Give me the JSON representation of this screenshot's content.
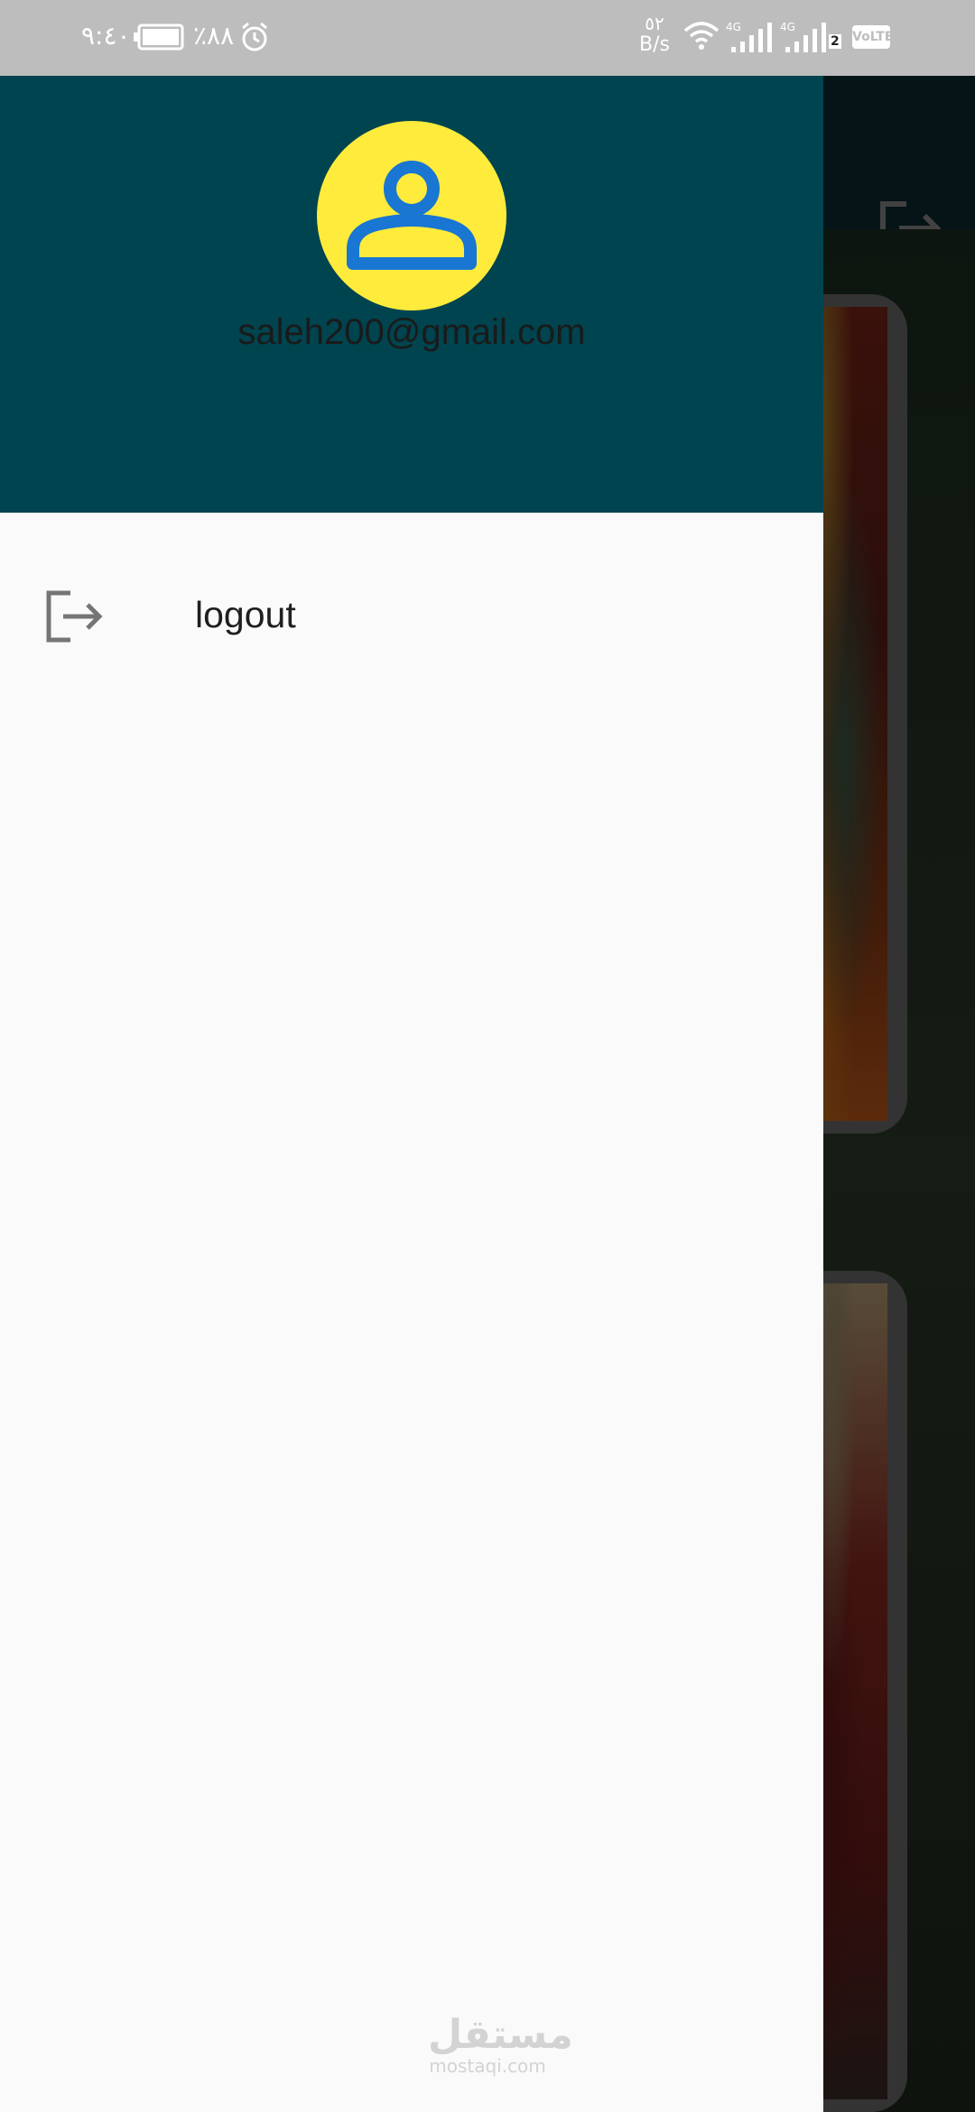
{
  "status_bar": {
    "time": "٩:٤٠",
    "battery": "٪٨٨",
    "network_speed": "٥٢",
    "network_speed_unit": "B/s",
    "network_type_1": "4G",
    "network_type_2": "4G",
    "sim_number": "2",
    "volte": "VoLTE"
  },
  "drawer": {
    "user_email": "saleh200@gmail.com",
    "avatar_icon": "person-outline-icon",
    "menu_items": [
      {
        "label": "logout",
        "icon": "logout-icon"
      }
    ]
  },
  "watermark": {
    "arabic": "مستقل",
    "latin": "mostaqi.com"
  },
  "colors": {
    "drawer_header": "#00444f",
    "avatar_bg": "#ffeb3b",
    "avatar_icon": "#1976d2",
    "drawer_bg": "#fafafa",
    "status_bar": "#bdbdbd"
  }
}
